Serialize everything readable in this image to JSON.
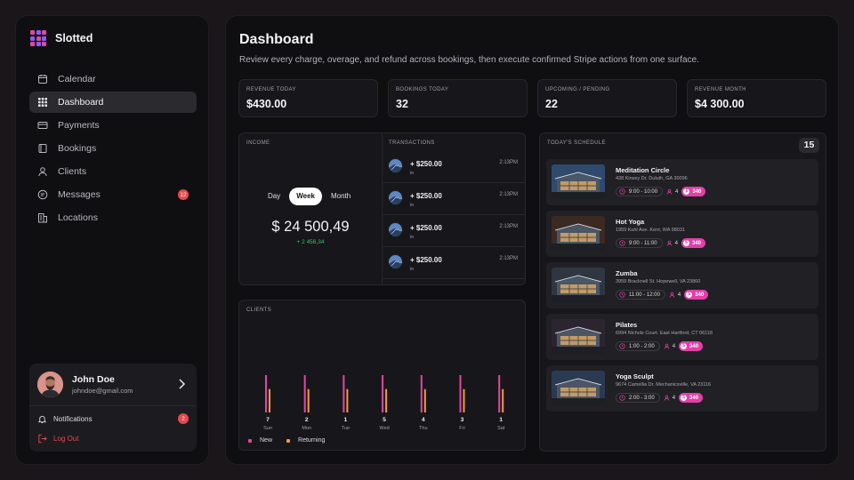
{
  "brand": {
    "name": "Slotted"
  },
  "sidebar": {
    "items": [
      {
        "label": "Calendar",
        "icon": "calendar-icon"
      },
      {
        "label": "Dashboard",
        "icon": "grid-icon",
        "active": true
      },
      {
        "label": "Payments",
        "icon": "card-icon"
      },
      {
        "label": "Bookings",
        "icon": "book-icon"
      },
      {
        "label": "Clients",
        "icon": "user-icon"
      },
      {
        "label": "Messages",
        "icon": "message-icon",
        "badge": "12"
      },
      {
        "label": "Locations",
        "icon": "building-icon"
      }
    ]
  },
  "user": {
    "name": "John Doe",
    "email": "johndoe@gmail.com",
    "notifications_label": "Notifications",
    "notifications_count": "2",
    "logout_label": "Log Out"
  },
  "header": {
    "title": "Dashboard",
    "subtitle": "Review every charge, overage, and refund across bookings, then execute confirmed Stripe actions from one surface."
  },
  "stats": [
    {
      "label": "REVENUE TODAY",
      "value": "$430.00"
    },
    {
      "label": "BOOKINGS TODAY",
      "value": "32"
    },
    {
      "label": "UPCOMING / PENDING",
      "value": "22"
    },
    {
      "label": "REVENUE MONTH",
      "value": "$4 300.00"
    }
  ],
  "income": {
    "label": "INCOME",
    "tabs": [
      "Day",
      "Week",
      "Month"
    ],
    "active_tab": "Week",
    "value": "$ 24 500,49",
    "delta": "+ 2 456,34"
  },
  "transactions": {
    "label": "TRANSACTIONS",
    "items": [
      {
        "amount": "+ $250.00",
        "direction": "in",
        "time": "2:13PM"
      },
      {
        "amount": "+ $250.00",
        "direction": "in",
        "time": "2:13PM"
      },
      {
        "amount": "+ $250.00",
        "direction": "in",
        "time": "2:13PM"
      },
      {
        "amount": "+ $250.00",
        "direction": "in",
        "time": "2:13PM"
      }
    ]
  },
  "clients": {
    "label": "CLIENTS"
  },
  "chart_data": {
    "type": "bar",
    "categories": [
      "Sun",
      "Mon",
      "Tue",
      "Wed",
      "Thu",
      "Fri",
      "Sat"
    ],
    "totals": [
      "7",
      "2",
      "1",
      "5",
      "4",
      "3",
      "1"
    ],
    "series": [
      {
        "name": "New",
        "color": "#e0489f",
        "values": [
          8,
          8,
          8,
          8,
          8,
          8,
          8
        ]
      },
      {
        "name": "Returning",
        "color": "#f29a3c",
        "values": [
          5,
          5,
          5,
          5,
          5,
          5,
          5
        ]
      }
    ],
    "ylim": [
      0,
      8
    ]
  },
  "schedule": {
    "label": "TODAY'S SCHEDULE",
    "count": "15",
    "items": [
      {
        "name": "Meditation Circle",
        "address": "438 Kinsey Dr. Duluth, GA 30096",
        "time": "9:00 - 10:00",
        "capacity": "4",
        "price": "340"
      },
      {
        "name": "Hot Yoga",
        "address": "1959 Kuhl Ave. Kent, WA 98031",
        "time": "9:00 - 11:00",
        "capacity": "4",
        "price": "340"
      },
      {
        "name": "Zumba",
        "address": "3959 Bracknell St. Hopewell, VA 23860",
        "time": "11:00 - 12:00",
        "capacity": "4",
        "price": "340"
      },
      {
        "name": "Pilates",
        "address": "6994 Nichols Court. East Hartford, CT 06118",
        "time": "1:00 - 2:00",
        "capacity": "4",
        "price": "340"
      },
      {
        "name": "Yoga Sculpt",
        "address": "9674 Camellia Dr. Mechanicsville, VA 23116",
        "time": "2:00 - 3:00",
        "capacity": "4",
        "price": "340"
      }
    ]
  },
  "colors": {
    "accent": "#e33fa8",
    "badge": "#e5484d",
    "positive": "#3fbf6f",
    "logo": [
      "#e0489f",
      "#8a5cf6",
      "#e0489f",
      "#8a5cf6",
      "#e0489f",
      "#8a5cf6",
      "#e0489f",
      "#8a5cf6",
      "#e0489f"
    ]
  }
}
